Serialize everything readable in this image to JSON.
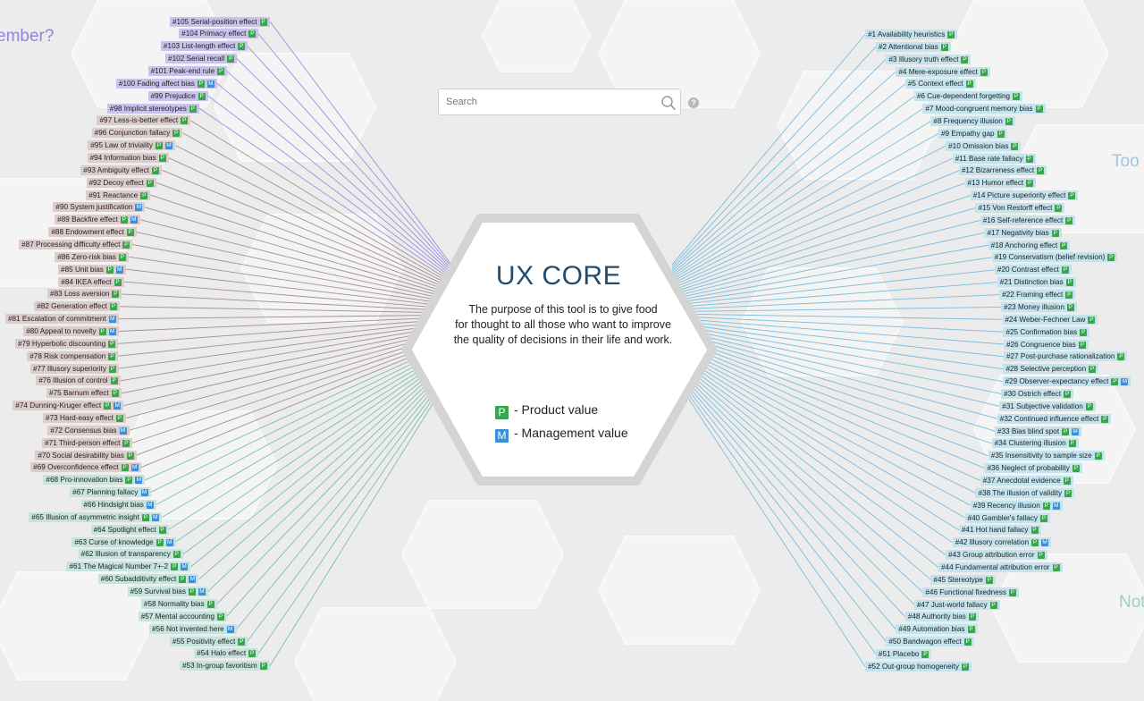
{
  "edge_labels": {
    "top_left": "ember?",
    "right_top": "Too",
    "right_bottom": "Not"
  },
  "search": {
    "placeholder": "Search",
    "help": "?"
  },
  "core": {
    "title": "UX CORE",
    "description": "The purpose of this tool is to give food\nfor thought to all those who want to improve\nthe quality of decisions in their life and work."
  },
  "legend": {
    "product": {
      "badge": "P",
      "label": "- Product value"
    },
    "management": {
      "badge": "M",
      "label": "- Management value"
    }
  },
  "colors": {
    "product_badge": "#3aa64b",
    "management_badge": "#3b8fd8",
    "title": "#1f4e72",
    "chip_purple": "#c9c3ec",
    "chip_brown": "#dccdcc",
    "chip_teal": "#c6e4dd",
    "chip_blue": "#c3e4ef",
    "line_purple": "#8f86dc",
    "line_brown": "#9c8585",
    "line_teal": "#6fb9a8",
    "line_blue": "#6fb6d9"
  },
  "biases_left": [
    {
      "label": "#105 Serial-position effect",
      "badges": [
        "P"
      ],
      "group": "purple"
    },
    {
      "label": "#104 Primacy effect",
      "badges": [
        "P"
      ],
      "group": "purple"
    },
    {
      "label": "#103 List-length effect",
      "badges": [
        "P"
      ],
      "group": "purple"
    },
    {
      "label": "#102 Serial recall",
      "badges": [
        "P"
      ],
      "group": "purple"
    },
    {
      "label": "#101 Peak-end rule",
      "badges": [
        "P"
      ],
      "group": "purple"
    },
    {
      "label": "#100 Fading affect bias",
      "badges": [
        "P",
        "M"
      ],
      "group": "purple"
    },
    {
      "label": "#99 Prejudice",
      "badges": [
        "P"
      ],
      "group": "purple"
    },
    {
      "label": "#98 Implicit stereotypes",
      "badges": [
        "P"
      ],
      "group": "purple"
    },
    {
      "label": "#97 Less-is-better effect",
      "badges": [
        "P"
      ],
      "group": "brown"
    },
    {
      "label": "#96 Conjunction fallacy",
      "badges": [
        "P"
      ],
      "group": "brown"
    },
    {
      "label": "#95 Law of triviality",
      "badges": [
        "P",
        "M"
      ],
      "group": "brown"
    },
    {
      "label": "#94 Information bias",
      "badges": [
        "P"
      ],
      "group": "brown"
    },
    {
      "label": "#93 Ambiguity effect",
      "badges": [
        "P"
      ],
      "group": "brown"
    },
    {
      "label": "#92 Decoy effect",
      "badges": [
        "P"
      ],
      "group": "brown"
    },
    {
      "label": "#91 Reactance",
      "badges": [
        "P"
      ],
      "group": "brown"
    },
    {
      "label": "#90 System justification",
      "badges": [
        "M"
      ],
      "group": "brown"
    },
    {
      "label": "#89 Backfire effect",
      "badges": [
        "P",
        "M"
      ],
      "group": "brown"
    },
    {
      "label": "#88 Endowment effect",
      "badges": [
        "P"
      ],
      "group": "brown"
    },
    {
      "label": "#87 Processing difficulty effect",
      "badges": [
        "P"
      ],
      "group": "brown"
    },
    {
      "label": "#86 Zero-risk bias",
      "badges": [
        "P"
      ],
      "group": "brown"
    },
    {
      "label": "#85 Unit bias",
      "badges": [
        "P",
        "M"
      ],
      "group": "brown"
    },
    {
      "label": "#84 IKEA effect",
      "badges": [
        "P"
      ],
      "group": "brown"
    },
    {
      "label": "#83 Loss aversion",
      "badges": [
        "P"
      ],
      "group": "brown"
    },
    {
      "label": "#82 Generation effect",
      "badges": [
        "P"
      ],
      "group": "brown"
    },
    {
      "label": "#81 Escalation of commitment",
      "badges": [
        "M"
      ],
      "group": "brown"
    },
    {
      "label": "#80 Appeal to novelty",
      "badges": [
        "P",
        "M"
      ],
      "group": "brown"
    },
    {
      "label": "#79 Hyperbolic discounting",
      "badges": [
        "P"
      ],
      "group": "brown"
    },
    {
      "label": "#78 Risk compensation",
      "badges": [
        "P"
      ],
      "group": "brown"
    },
    {
      "label": "#77 Illusory superiority",
      "badges": [
        "P"
      ],
      "group": "brown"
    },
    {
      "label": "#76 Illusion of control",
      "badges": [
        "P"
      ],
      "group": "brown"
    },
    {
      "label": "#75 Barnum effect",
      "badges": [
        "P"
      ],
      "group": "brown"
    },
    {
      "label": "#74 Dunning-Kruger effect",
      "badges": [
        "P",
        "M"
      ],
      "group": "brown"
    },
    {
      "label": "#73 Hard-easy effect",
      "badges": [
        "P"
      ],
      "group": "brown"
    },
    {
      "label": "#72 Consensus bias",
      "badges": [
        "M"
      ],
      "group": "brown"
    },
    {
      "label": "#71 Third-person effect",
      "badges": [
        "P"
      ],
      "group": "brown"
    },
    {
      "label": "#70 Social desirability bias",
      "badges": [
        "P"
      ],
      "group": "brown"
    },
    {
      "label": "#69 Overconfidence effect",
      "badges": [
        "P",
        "M"
      ],
      "group": "brown"
    },
    {
      "label": "#68 Pro-innovation bias",
      "badges": [
        "P",
        "M"
      ],
      "group": "teal"
    },
    {
      "label": "#67 Planning fallacy",
      "badges": [
        "M"
      ],
      "group": "teal"
    },
    {
      "label": "#66 Hindsight bias",
      "badges": [
        "M"
      ],
      "group": "teal"
    },
    {
      "label": "#65 Illusion of asymmetric insight",
      "badges": [
        "P",
        "M"
      ],
      "group": "teal"
    },
    {
      "label": "#64 Spotlight effect",
      "badges": [
        "P"
      ],
      "group": "teal"
    },
    {
      "label": "#63 Curse of knowledge",
      "badges": [
        "P",
        "M"
      ],
      "group": "teal"
    },
    {
      "label": "#62 Illusion of transparency",
      "badges": [
        "P"
      ],
      "group": "teal"
    },
    {
      "label": "#61 The Magical Number 7+-2",
      "badges": [
        "P",
        "M"
      ],
      "group": "teal"
    },
    {
      "label": "#60 Subadditivity effect",
      "badges": [
        "P",
        "M"
      ],
      "group": "teal"
    },
    {
      "label": "#59 Survival bias",
      "badges": [
        "P",
        "M"
      ],
      "group": "teal"
    },
    {
      "label": "#58 Normality bias",
      "badges": [
        "P"
      ],
      "group": "teal"
    },
    {
      "label": "#57 Mental accounting",
      "badges": [
        "P"
      ],
      "group": "teal"
    },
    {
      "label": "#56 Not invented here",
      "badges": [
        "M"
      ],
      "group": "teal"
    },
    {
      "label": "#55 Positivity effect",
      "badges": [
        "P"
      ],
      "group": "teal"
    },
    {
      "label": "#54 Halo effect",
      "badges": [
        "P"
      ],
      "group": "teal"
    },
    {
      "label": "#53 In-group favoritism",
      "badges": [
        "P"
      ],
      "group": "teal"
    }
  ],
  "biases_right": [
    {
      "label": "#1 Availability heuristics",
      "badges": [
        "P"
      ],
      "group": "blue"
    },
    {
      "label": "#2 Attentional bias",
      "badges": [
        "P"
      ],
      "group": "blue"
    },
    {
      "label": "#3 Illusory truth effect",
      "badges": [
        "P"
      ],
      "group": "blue"
    },
    {
      "label": "#4 Mere-exposure effect",
      "badges": [
        "P"
      ],
      "group": "blue"
    },
    {
      "label": "#5 Context effect",
      "badges": [
        "P"
      ],
      "group": "blue"
    },
    {
      "label": "#6 Cue-dependent forgetting",
      "badges": [
        "P"
      ],
      "group": "blue"
    },
    {
      "label": "#7 Mood-congruent memory bias",
      "badges": [
        "P"
      ],
      "group": "blue"
    },
    {
      "label": "#8 Frequency illusion",
      "badges": [
        "P"
      ],
      "group": "blue"
    },
    {
      "label": "#9 Empathy gap",
      "badges": [
        "P"
      ],
      "group": "blue"
    },
    {
      "label": "#10 Omission bias",
      "badges": [
        "P"
      ],
      "group": "blue"
    },
    {
      "label": "#11 Base rate fallacy",
      "badges": [
        "P"
      ],
      "group": "blue"
    },
    {
      "label": "#12 Bizarreness effect",
      "badges": [
        "P"
      ],
      "group": "blue"
    },
    {
      "label": "#13 Humor effect",
      "badges": [
        "P"
      ],
      "group": "blue"
    },
    {
      "label": "#14 Picture superiority effect",
      "badges": [
        "P"
      ],
      "group": "blue"
    },
    {
      "label": "#15 Von Restorff effect",
      "badges": [
        "P"
      ],
      "group": "blue"
    },
    {
      "label": "#16 Self-reference effect",
      "badges": [
        "P"
      ],
      "group": "blue"
    },
    {
      "label": "#17 Negativity bias",
      "badges": [
        "P"
      ],
      "group": "blue"
    },
    {
      "label": "#18 Anchoring effect",
      "badges": [
        "P"
      ],
      "group": "blue"
    },
    {
      "label": "#19 Conservatism (belief revision)",
      "badges": [
        "P"
      ],
      "group": "blue"
    },
    {
      "label": "#20 Contrast effect",
      "badges": [
        "P"
      ],
      "group": "blue"
    },
    {
      "label": "#21 Distinction bias",
      "badges": [
        "P"
      ],
      "group": "blue"
    },
    {
      "label": "#22 Framing effect",
      "badges": [
        "P"
      ],
      "group": "blue"
    },
    {
      "label": "#23 Money illusion",
      "badges": [
        "P"
      ],
      "group": "blue"
    },
    {
      "label": "#24 Weber-Fechner Law",
      "badges": [
        "P"
      ],
      "group": "blue"
    },
    {
      "label": "#25 Confirmation bias",
      "badges": [
        "P"
      ],
      "group": "blue"
    },
    {
      "label": "#26 Congruence bias",
      "badges": [
        "P"
      ],
      "group": "blue"
    },
    {
      "label": "#27 Post-purchase rationalization",
      "badges": [
        "P"
      ],
      "group": "blue"
    },
    {
      "label": "#28 Selective perception",
      "badges": [
        "P"
      ],
      "group": "blue"
    },
    {
      "label": "#29 Observer-expectancy effect",
      "badges": [
        "P",
        "M"
      ],
      "group": "blue"
    },
    {
      "label": "#30 Ostrich effect",
      "badges": [
        "P"
      ],
      "group": "blue"
    },
    {
      "label": "#31 Subjective validation",
      "badges": [
        "P"
      ],
      "group": "blue"
    },
    {
      "label": "#32 Continued influence effect",
      "badges": [
        "P"
      ],
      "group": "blue"
    },
    {
      "label": "#33 Bias blind spot",
      "badges": [
        "P",
        "M"
      ],
      "group": "blue"
    },
    {
      "label": "#34 Clustering illusion",
      "badges": [
        "P"
      ],
      "group": "blue"
    },
    {
      "label": "#35 Insensitivity to sample size",
      "badges": [
        "P"
      ],
      "group": "blue"
    },
    {
      "label": "#36 Neglect of probability",
      "badges": [
        "P"
      ],
      "group": "blue"
    },
    {
      "label": "#37 Anecdotal evidence",
      "badges": [
        "P"
      ],
      "group": "blue"
    },
    {
      "label": "#38 The illusion of validity",
      "badges": [
        "P"
      ],
      "group": "blue"
    },
    {
      "label": "#39 Recency illusion",
      "badges": [
        "P",
        "M"
      ],
      "group": "blue"
    },
    {
      "label": "#40 Gambler's fallacy",
      "badges": [
        "P"
      ],
      "group": "blue"
    },
    {
      "label": "#41 Hot hand fallacy",
      "badges": [
        "P"
      ],
      "group": "blue"
    },
    {
      "label": "#42 Illusory correlation",
      "badges": [
        "P",
        "M"
      ],
      "group": "blue"
    },
    {
      "label": "#43 Group attribution error",
      "badges": [
        "P"
      ],
      "group": "blue"
    },
    {
      "label": "#44 Fundamental attribution error",
      "badges": [
        "P"
      ],
      "group": "blue"
    },
    {
      "label": "#45 Stereotype",
      "badges": [
        "P"
      ],
      "group": "blue"
    },
    {
      "label": "#46 Functional fixedness",
      "badges": [
        "P"
      ],
      "group": "blue"
    },
    {
      "label": "#47 Just-world fallacy",
      "badges": [
        "P"
      ],
      "group": "blue"
    },
    {
      "label": "#48 Authority bias",
      "badges": [
        "P"
      ],
      "group": "blue"
    },
    {
      "label": "#49 Automation bias",
      "badges": [
        "P"
      ],
      "group": "blue"
    },
    {
      "label": "#50 Bandwagon effect",
      "badges": [
        "P"
      ],
      "group": "blue"
    },
    {
      "label": "#51 Placebo",
      "badges": [
        "P"
      ],
      "group": "blue"
    },
    {
      "label": "#52 Out-group homogeneity",
      "badges": [
        "P"
      ],
      "group": "blue"
    }
  ]
}
